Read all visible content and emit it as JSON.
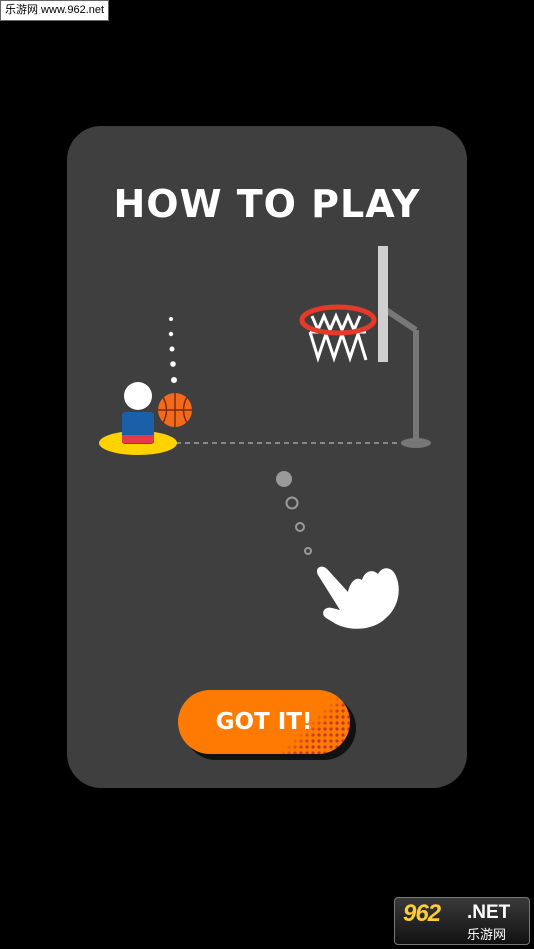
{
  "watermark_top": "乐游网 www.962.net",
  "dialog": {
    "title": "HOW TO PLAY",
    "button_label": "GOT IT!"
  },
  "watermark_bottom": {
    "number": "962",
    "domain": ".NET",
    "chinese": "乐游网"
  },
  "colors": {
    "panel": "#3f3f3f",
    "button": "#ff7a00",
    "hoop": "#e53a2a",
    "player_base": "#ffd200",
    "ball": "#f36a1d"
  },
  "icons": [
    "basketball-icon",
    "hoop-icon",
    "player-icon",
    "pointing-hand-icon"
  ]
}
